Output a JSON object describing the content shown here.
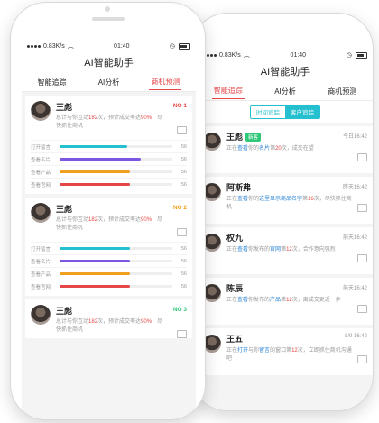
{
  "colors": {
    "accent": "#e54646",
    "teal": "#25c0cf",
    "purple": "#7b57e0",
    "orange": "#f0a020",
    "red": "#e54646",
    "green": "#31c77a",
    "blue": "#2b84d6"
  },
  "front": {
    "status": {
      "speed": "0.83K/s",
      "time": "01:40"
    },
    "title": "AI智能助手",
    "tabs": [
      "智能追踪",
      "AI分析",
      "商机预测"
    ],
    "cards": [
      {
        "name": "王彪",
        "desc": [
          "总计与你互动",
          "182",
          "次，预计成交率达",
          "90%",
          "，尽快抓住商机"
        ],
        "rank": "NO 1",
        "rank_color": "#e54646",
        "bars": [
          {
            "label": "打开留言",
            "val": "56",
            "fill": 0.6,
            "color": "#25c0cf"
          },
          {
            "label": "查看名片",
            "val": "56",
            "fill": 0.72,
            "color": "#7b57e0"
          },
          {
            "label": "查看产品",
            "val": "56",
            "fill": 0.62,
            "color": "#f0a020"
          },
          {
            "label": "查看官网",
            "val": "56",
            "fill": 0.62,
            "color": "#e54646"
          }
        ]
      },
      {
        "name": "王彪",
        "desc": [
          "总计与你互动",
          "182",
          "次，预计成交率达",
          "90%",
          "，尽快抓住商机"
        ],
        "rank": "NO 2",
        "rank_color": "#f0a020",
        "bars": [
          {
            "label": "打开留言",
            "val": "56",
            "fill": 0.62,
            "color": "#25c0cf"
          },
          {
            "label": "查看名片",
            "val": "56",
            "fill": 0.62,
            "color": "#7b57e0"
          },
          {
            "label": "查看产品",
            "val": "56",
            "fill": 0.62,
            "color": "#f0a020"
          },
          {
            "label": "查看官网",
            "val": "56",
            "fill": 0.62,
            "color": "#e54646"
          }
        ]
      },
      {
        "name": "王彪",
        "desc": [
          "总计与你互动",
          "182",
          "次，预计成交率达",
          "90%",
          "，尽快抓住商机"
        ],
        "rank": "NO 3",
        "rank_color": "#31c77a",
        "bars": []
      }
    ]
  },
  "back": {
    "status": {
      "speed": "0.83K/s",
      "time": "01:40"
    },
    "title": "AI智能助手",
    "tabs": [
      "智能追踪",
      "AI分析",
      "商机预测"
    ],
    "toggle": [
      "时间追踪",
      "客户追踪"
    ],
    "rows": [
      {
        "name": "王彪",
        "badge": "新客",
        "time": "今日16:42",
        "desc": [
          "正在",
          "查看",
          "你的",
          "名片",
          "第",
          "20",
          "次，成交在望"
        ]
      },
      {
        "name": "阿斯弗",
        "badge": "",
        "time": "昨天16:42",
        "desc": [
          "正在",
          "查看",
          "你的",
          "这里显示商品名字",
          "第",
          "16",
          "次，尽快抓住商机"
        ]
      },
      {
        "name": "权九",
        "badge": "",
        "time": "前天16:42",
        "desc": [
          "正在",
          "查看",
          "你发布的",
          "官网",
          "第",
          "12",
          "次，合作意向强烈"
        ]
      },
      {
        "name": "陈辰",
        "badge": "",
        "time": "前天16:42",
        "desc": [
          "正在",
          "查看",
          "你发布的",
          "产品",
          "第",
          "12",
          "次，离成交更近一步"
        ]
      },
      {
        "name": "王五",
        "badge": "",
        "time": "8/9 16:42",
        "desc": [
          "正在",
          "打开",
          "与你",
          "留言",
          "的窗口第",
          "12",
          "次，立即抓住商机沟通吧"
        ]
      }
    ]
  }
}
